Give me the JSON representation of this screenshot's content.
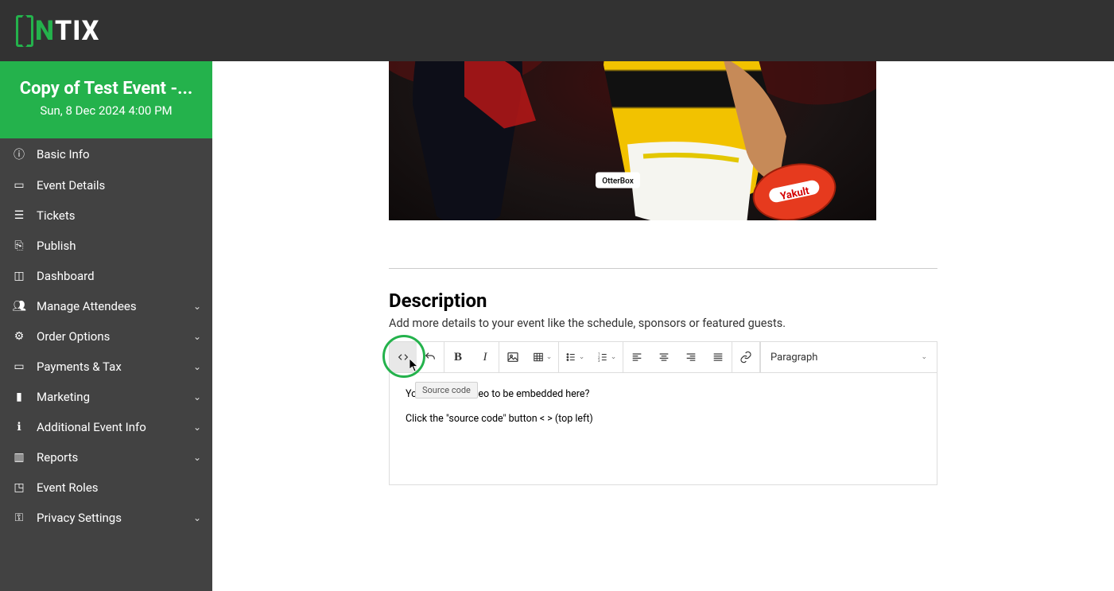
{
  "logo": {
    "part1": "N",
    "part2": "TIX"
  },
  "event": {
    "title": "Copy of Test Event -...",
    "date": "Sun, 8 Dec 2024 4:00 PM"
  },
  "sidebar": {
    "items": [
      {
        "icon": "info",
        "label": "Basic Info"
      },
      {
        "icon": "details",
        "label": "Event Details"
      },
      {
        "icon": "tickets",
        "label": "Tickets"
      },
      {
        "icon": "publish",
        "label": "Publish"
      },
      {
        "icon": "dashboard",
        "label": "Dashboard"
      },
      {
        "icon": "people",
        "label": "Manage Attendees",
        "expandable": true
      },
      {
        "icon": "gear",
        "label": "Order Options",
        "expandable": true
      },
      {
        "icon": "card",
        "label": "Payments & Tax",
        "expandable": true
      },
      {
        "icon": "chat",
        "label": "Marketing",
        "expandable": true
      },
      {
        "icon": "info-solid",
        "label": "Additional Event Info",
        "expandable": true
      },
      {
        "icon": "bar",
        "label": "Reports",
        "expandable": true
      },
      {
        "icon": "roles",
        "label": "Event Roles"
      },
      {
        "icon": "key",
        "label": "Privacy Settings",
        "expandable": true
      }
    ]
  },
  "description": {
    "title": "Description",
    "subtitle": "Add more details to your event like the schedule, sponsors or featured guests."
  },
  "toolbar": {
    "tooltip": "Source code",
    "paragraph_label": "Paragraph"
  },
  "editor": {
    "line1": "You want the video to be embedded here?",
    "line2": "Click the \"source code\" button < > (top left)"
  }
}
